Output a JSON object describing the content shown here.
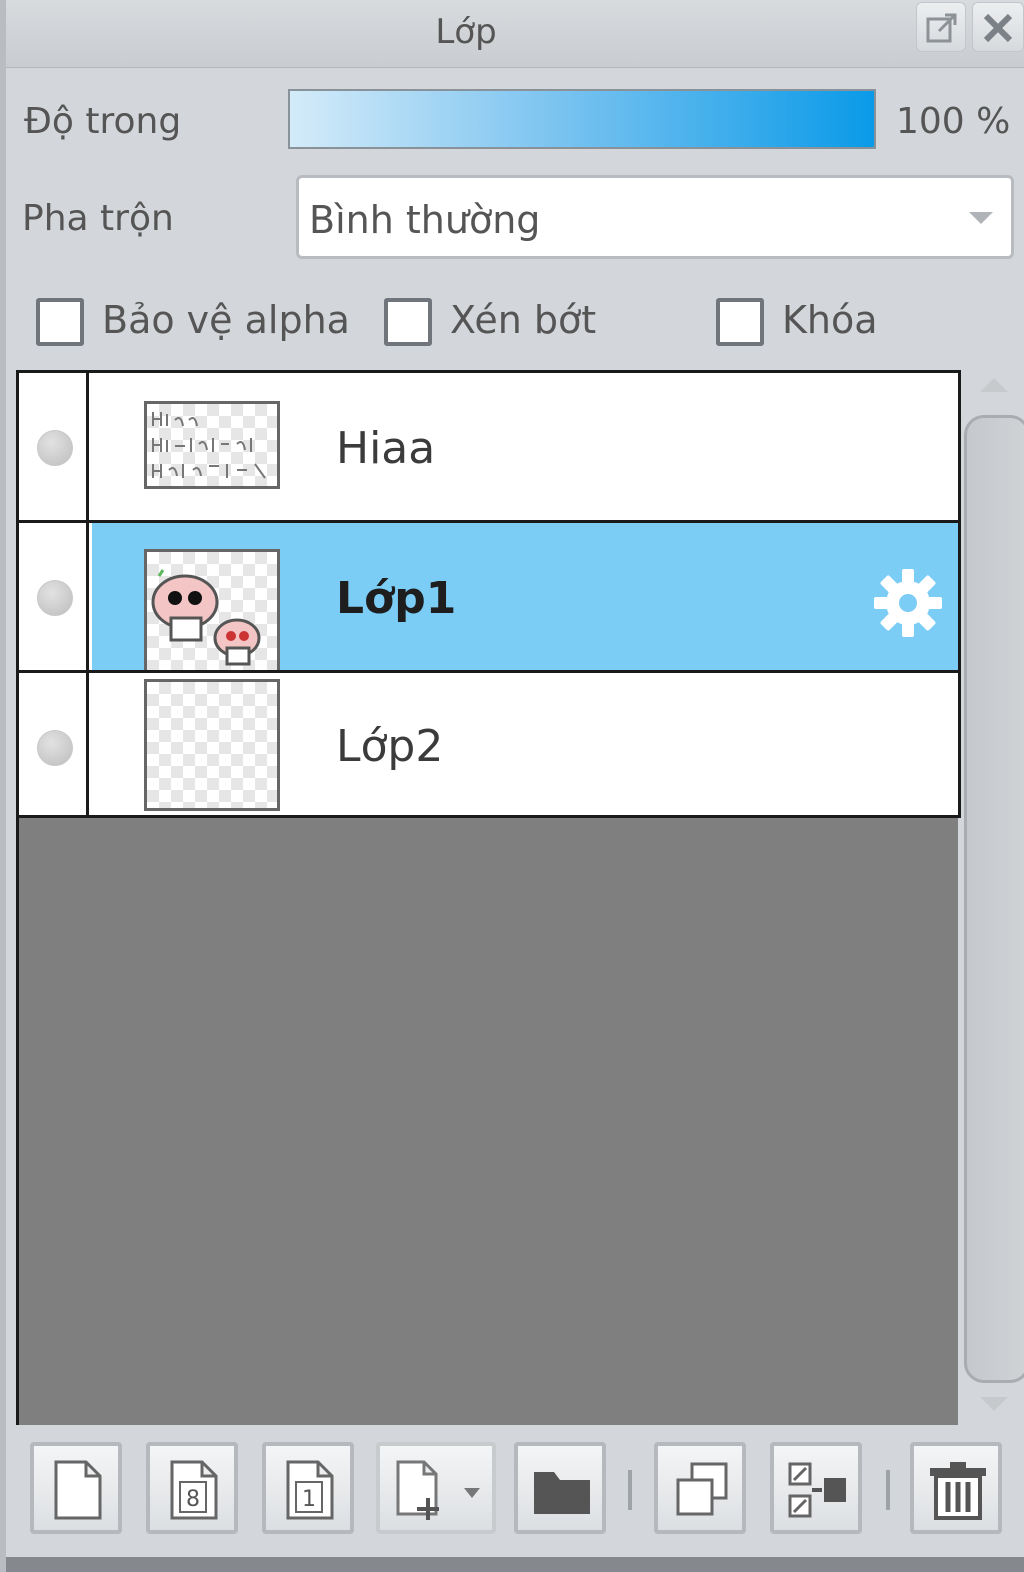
{
  "panel": {
    "title": "Lớp"
  },
  "opacity": {
    "label": "Độ trong",
    "value": "100 %",
    "level": 1.0
  },
  "blend": {
    "label": "Pha trộn",
    "value": "Bình thường"
  },
  "options": {
    "protect_alpha": "Bảo vệ alpha",
    "clip": "Xén bớt",
    "lock": "Khóa"
  },
  "layers": [
    {
      "name": "Hiaa",
      "selected": false,
      "thumb": "text-thumbnail"
    },
    {
      "name": "Lớp1",
      "selected": true,
      "thumb": "character-thumbnail"
    },
    {
      "name": "Lớp2",
      "selected": false,
      "thumb": "empty-thumbnail"
    }
  ],
  "toolbar": {
    "icons": [
      "new-layer-icon",
      "new-8bit-layer-icon",
      "new-1bit-layer-icon",
      "add-layer-menu-icon",
      "new-folder-icon",
      "duplicate-layer-icon",
      "merge-layer-icon",
      "delete-layer-icon"
    ]
  },
  "colors": {
    "selection": "#7ccdf6",
    "opacity_bar": "#0a9ae8",
    "background": "#7f7f7f"
  }
}
